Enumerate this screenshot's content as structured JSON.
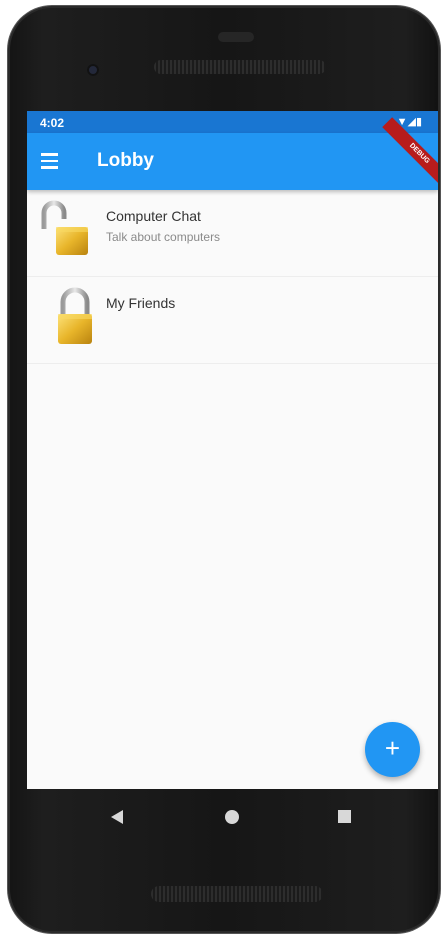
{
  "status_bar": {
    "time": "4:02",
    "icons": "▼◢▮"
  },
  "app_bar": {
    "title": "Lobby",
    "debug_banner": "DEBUG"
  },
  "rooms": [
    {
      "name": "Computer Chat",
      "description": "Talk about computers",
      "lock_state": "unlocked"
    },
    {
      "name": "My Friends",
      "description": "",
      "lock_state": "locked"
    }
  ],
  "fab": {
    "label": "+"
  },
  "colors": {
    "primary": "#2196f3",
    "status_bar": "#1976d2",
    "background": "#fafafa"
  }
}
